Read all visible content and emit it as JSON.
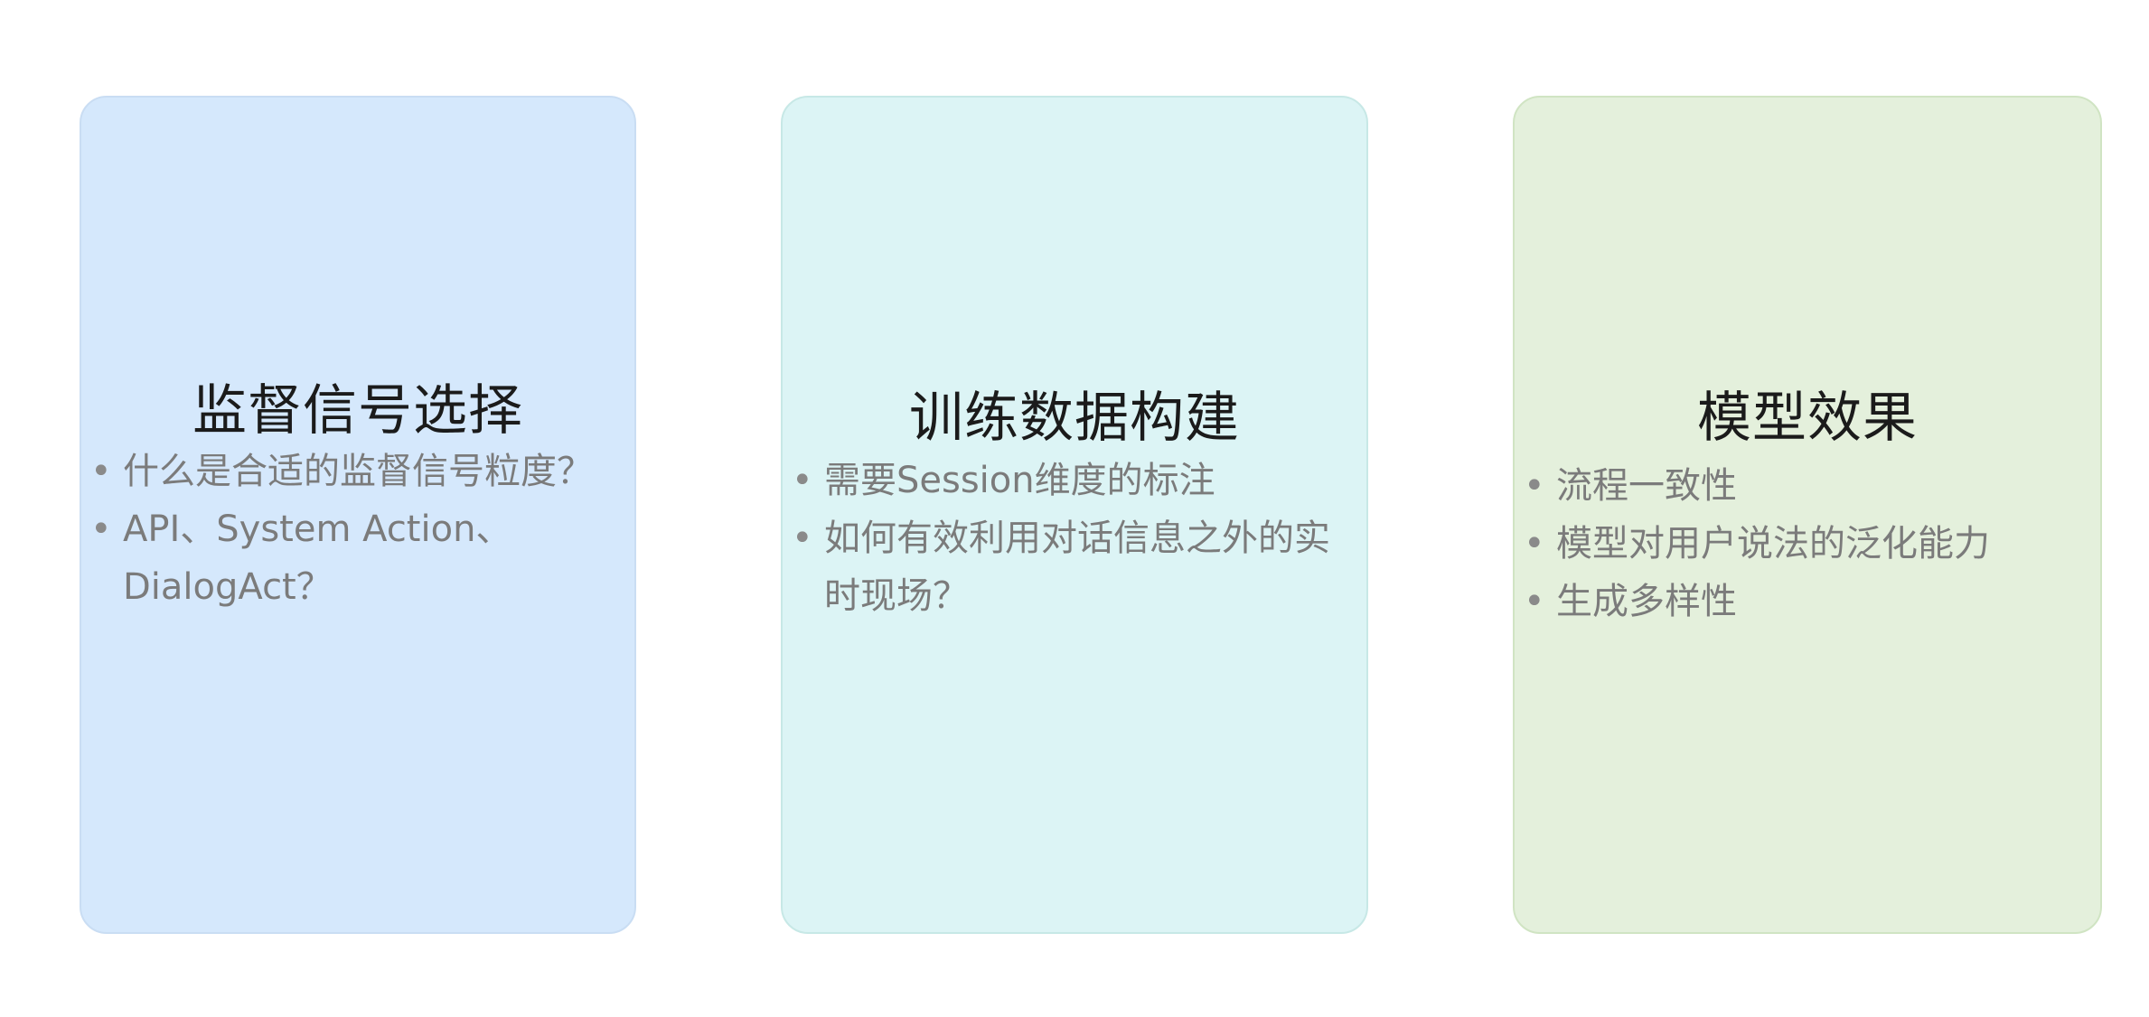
{
  "cards": [
    {
      "title": "监督信号选择",
      "bullets": [
        "什么是合适的监督信号粒度？",
        "API、System Action、DialogAct？"
      ]
    },
    {
      "title": "训练数据构建",
      "bullets": [
        "需要Session维度的标注",
        "如何有效利用对话信息之外的实时现场？"
      ]
    },
    {
      "title": "模型效果",
      "bullets": [
        "流程一致性",
        "模型对用户说法的泛化能力",
        "生成多样性"
      ]
    }
  ],
  "bullet_symbol": "•",
  "colors": {
    "card_1_bg": "#d5e8fc",
    "card_2_bg": "#dcf4f5",
    "card_3_bg": "#e4f0dc",
    "title_text": "#1b1b1b",
    "bullet_text": "#7b7b7b"
  }
}
